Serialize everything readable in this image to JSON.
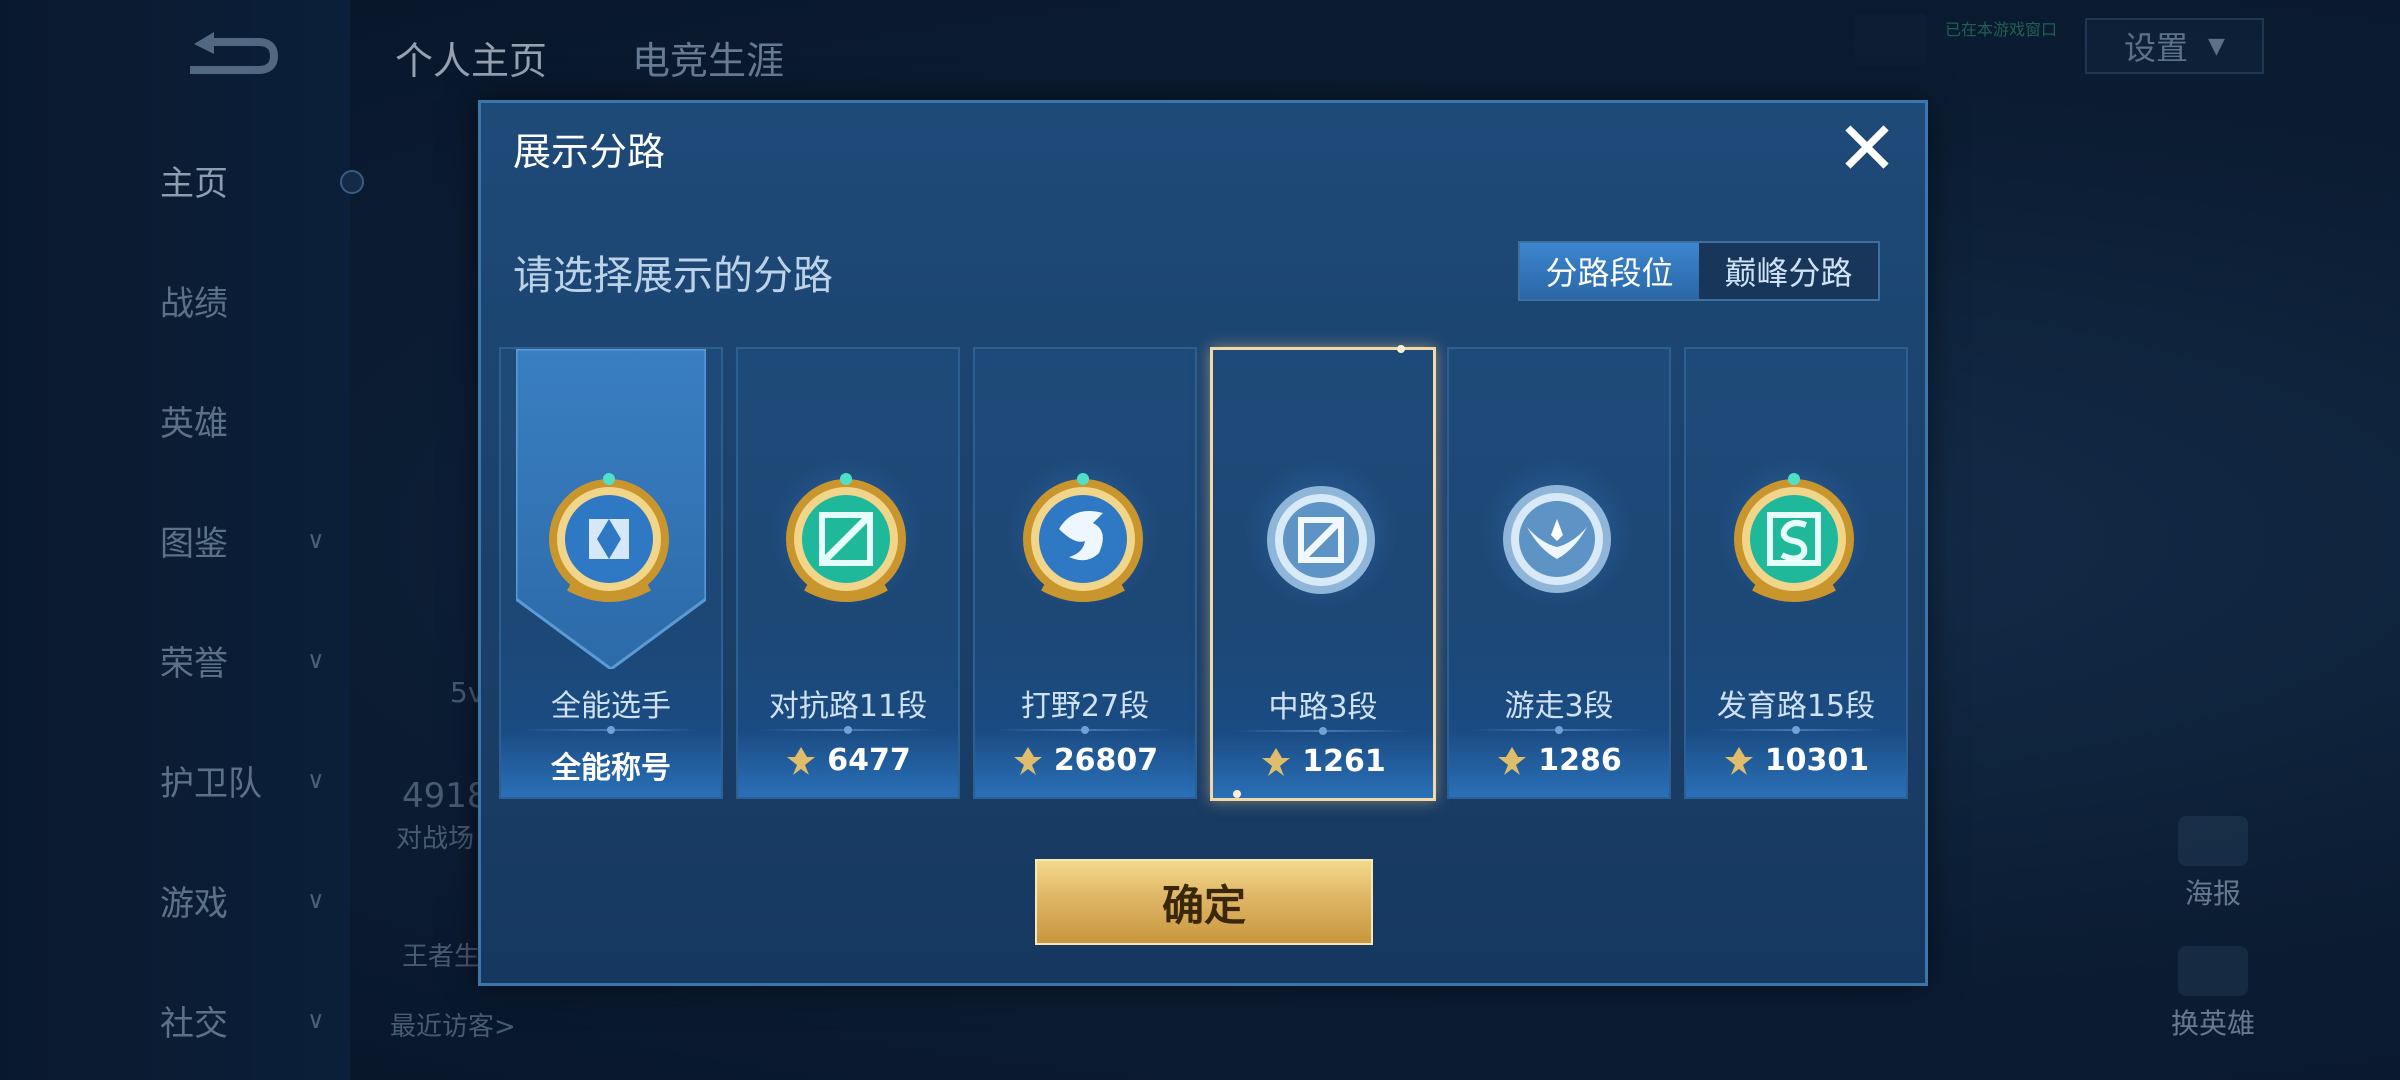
{
  "background": {
    "top_tabs": [
      "个人主页",
      "电竞生涯"
    ],
    "status_text": "已在本游戏窗口",
    "settings_label": "设置",
    "sidebar": [
      {
        "label": "主页",
        "chevron": false
      },
      {
        "label": "战绩",
        "chevron": false
      },
      {
        "label": "英雄",
        "chevron": false
      },
      {
        "label": "图鉴",
        "chevron": true
      },
      {
        "label": "荣誉",
        "chevron": true
      },
      {
        "label": "护卫队",
        "chevron": true
      },
      {
        "label": "游戏",
        "chevron": true
      },
      {
        "label": "社交",
        "chevron": true
      }
    ],
    "profile": {
      "level_text": "5v",
      "stat_value": "4918",
      "stat_label": "对战场",
      "brand_text": "王者生",
      "visitors_label": "最近访客>"
    },
    "right_buttons": [
      "海报",
      "换英雄"
    ]
  },
  "modal": {
    "title": "展示分路",
    "subtitle": "请选择展示的分路",
    "toggle": {
      "active": "分路段位",
      "inactive": "巅峰分路"
    },
    "cards": [
      {
        "name": "全能选手",
        "value": "全能称号",
        "emblem": "all-round-emblem",
        "selected": false,
        "has_score_icon": false
      },
      {
        "name": "对抗路11段",
        "value": "6477",
        "emblem": "clash-lane-emblem",
        "selected": false,
        "has_score_icon": true
      },
      {
        "name": "打野27段",
        "value": "26807",
        "emblem": "jungle-dragon-emblem",
        "selected": false,
        "has_score_icon": true
      },
      {
        "name": "中路3段",
        "value": "1261",
        "emblem": "mid-lane-emblem",
        "selected": true,
        "has_score_icon": true
      },
      {
        "name": "游走3段",
        "value": "1286",
        "emblem": "roam-wings-emblem",
        "selected": false,
        "has_score_icon": true
      },
      {
        "name": "发育路15段",
        "value": "10301",
        "emblem": "farm-lane-emblem",
        "selected": false,
        "has_score_icon": true
      }
    ],
    "confirm_label": "确定"
  },
  "colors": {
    "accent_gold": "#dfb565",
    "toggle_active": "#3c86cf",
    "selected_border": "#f2d8a8"
  }
}
